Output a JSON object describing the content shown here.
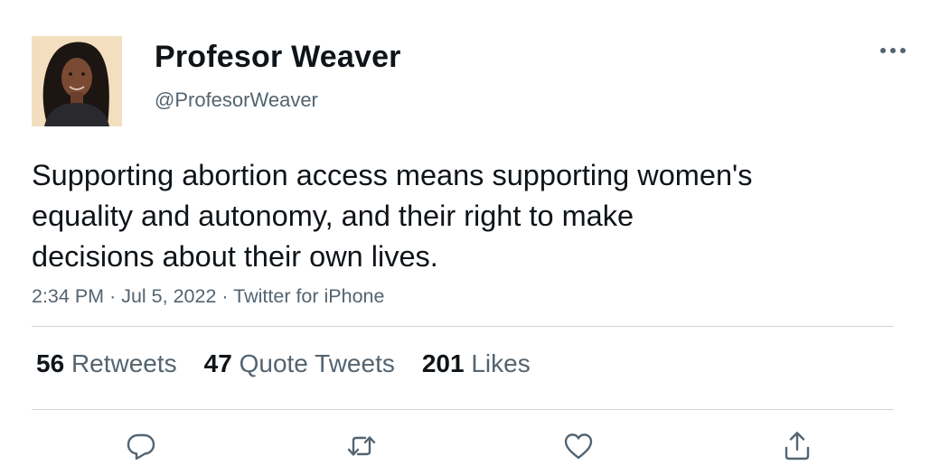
{
  "author": {
    "display_name": "Profesor Weaver",
    "handle": "@ProfesorWeaver",
    "avatar_icon": "profile-photo"
  },
  "tweet": {
    "text": "Supporting abortion access means supporting women's\nequality and autonomy, and their right to make\ndecisions about their own lives.",
    "time": "2:34 PM",
    "date": "Jul 5, 2022",
    "source": "Twitter for iPhone",
    "separator": "·"
  },
  "stats": {
    "retweets_count": "56",
    "retweets_label": "Retweets",
    "quotes_count": "47",
    "quotes_label": "Quote Tweets",
    "likes_count": "201",
    "likes_label": "Likes"
  },
  "actions": {
    "icons": [
      "reply-icon",
      "retweet-icon",
      "like-icon",
      "share-icon"
    ]
  },
  "colors": {
    "primary_text": "#0f1419",
    "secondary_text": "#536471",
    "divider": "#cfd9de"
  }
}
